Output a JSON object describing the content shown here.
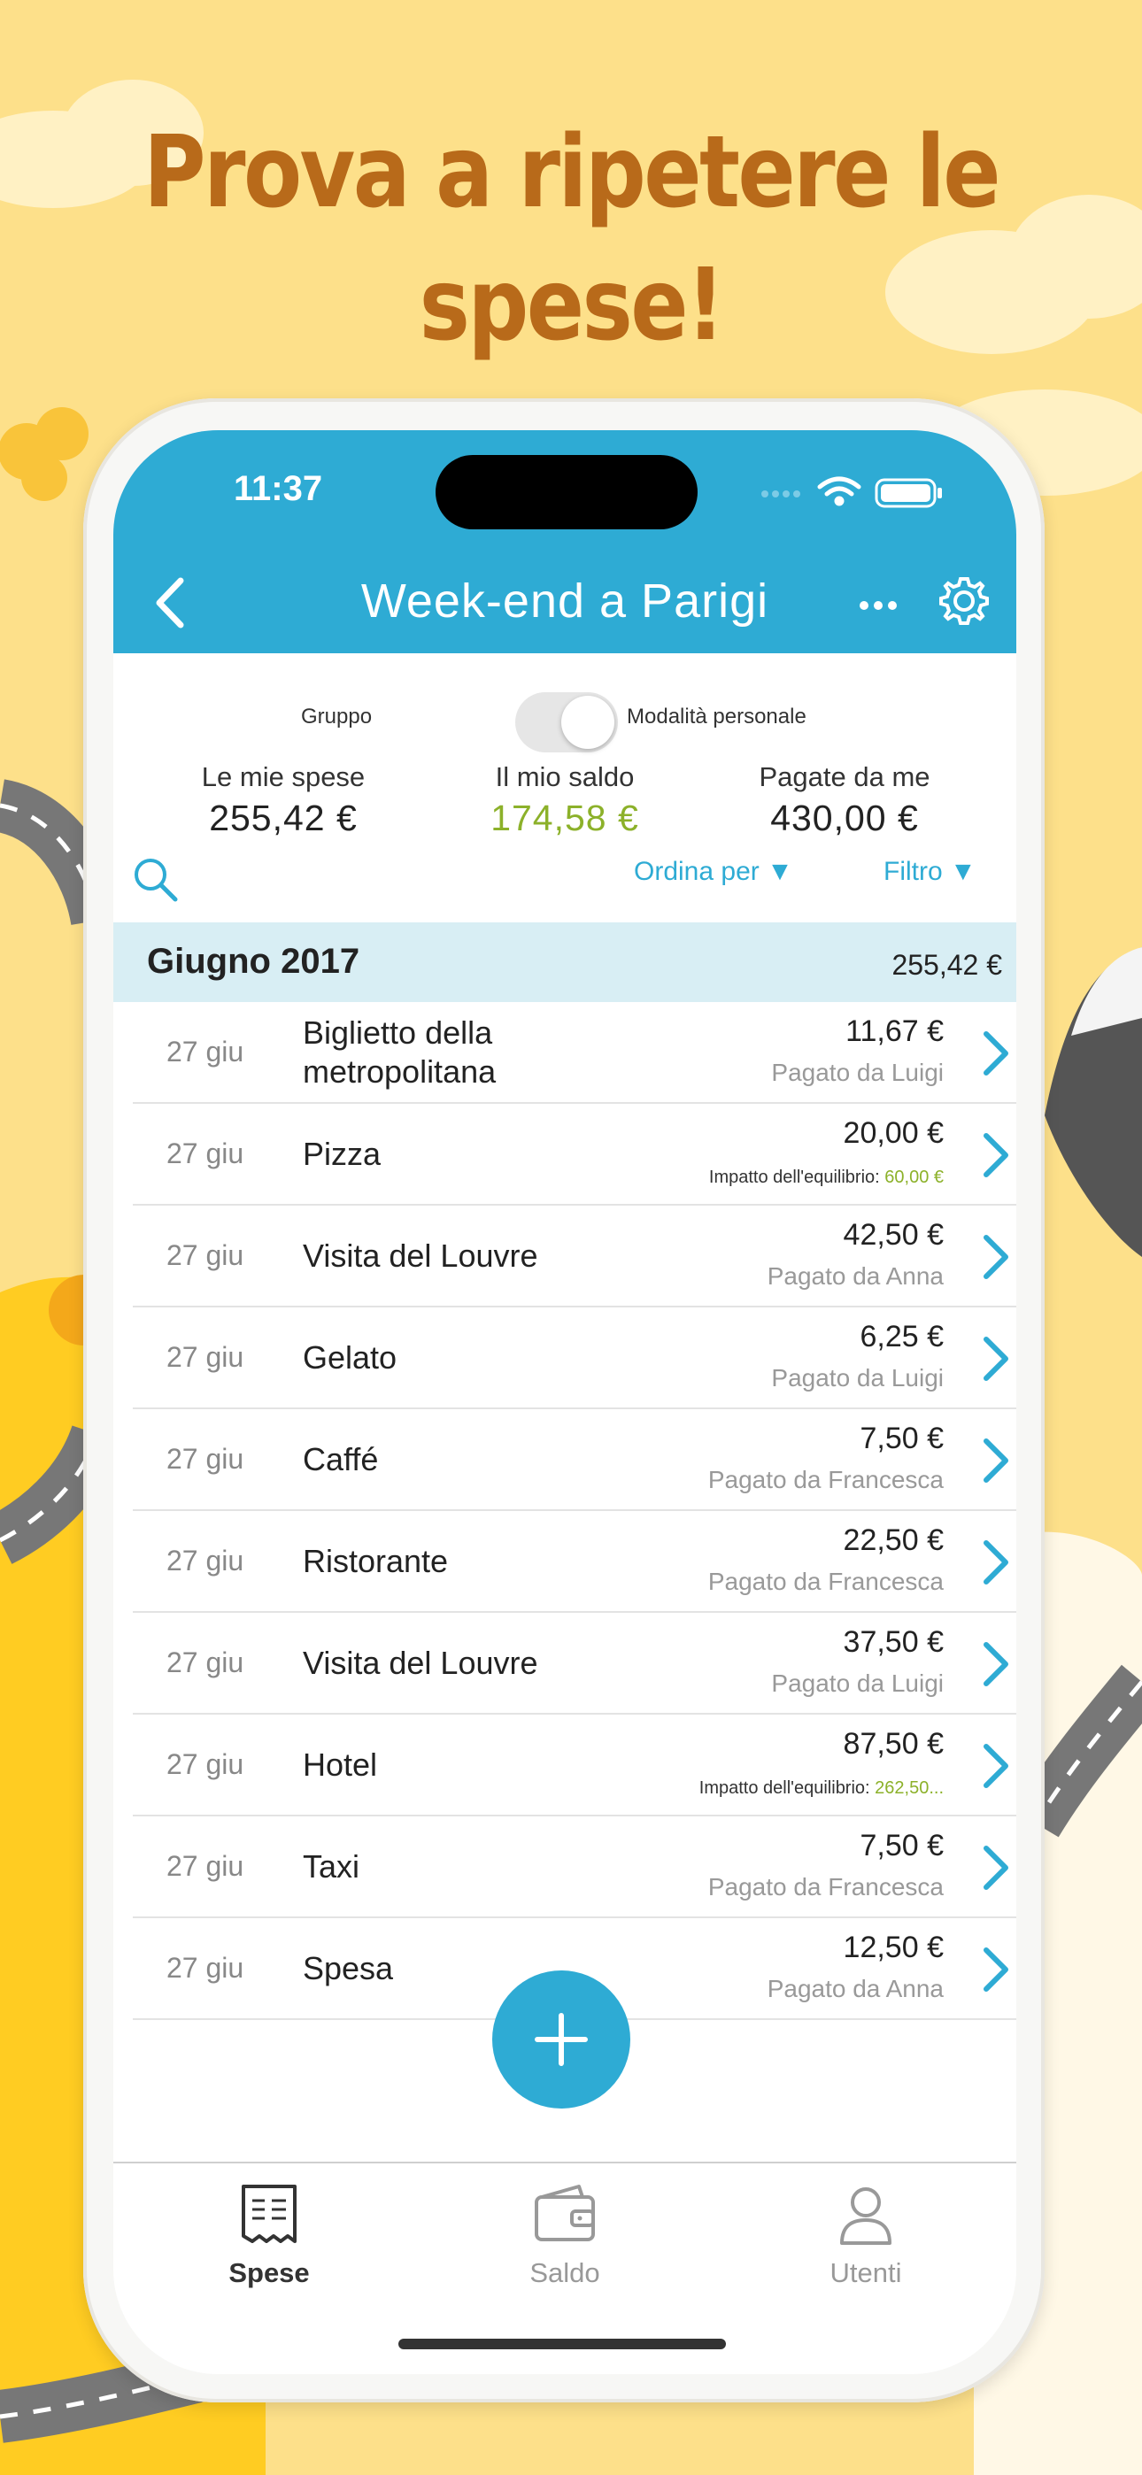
{
  "headline": "Prova a ripetere le spese!",
  "status_bar": {
    "time": "11:37"
  },
  "nav": {
    "title": "Week-end a Parigi"
  },
  "mode_toggle": {
    "left_label": "Gruppo",
    "right_label": "Modalità personale"
  },
  "summary": [
    {
      "label": "Le mie spese",
      "value": "255,42 €"
    },
    {
      "label": "Il mio saldo",
      "value": "174,58 €"
    },
    {
      "label": "Pagate da me",
      "value": "430,00 €"
    }
  ],
  "toolbar": {
    "sort_label": "Ordina per ▼",
    "filter_label": "Filtro ▼"
  },
  "month": {
    "title": "Giugno 2017",
    "total": "255,42 €"
  },
  "expenses": [
    {
      "date": "27 giu",
      "name": "Biglietto della metropolitana",
      "amount": "11,67 €",
      "sub": "Pagato da Luigi",
      "impact": false
    },
    {
      "date": "27 giu",
      "name": "Pizza",
      "amount": "20,00 €",
      "sub": "Impatto dell'equilibrio: ",
      "impact_value": "60,00 €",
      "impact": true
    },
    {
      "date": "27 giu",
      "name": "Visita del Louvre",
      "amount": "42,50 €",
      "sub": "Pagato da Anna",
      "impact": false
    },
    {
      "date": "27 giu",
      "name": "Gelato",
      "amount": "6,25 €",
      "sub": "Pagato da Luigi",
      "impact": false
    },
    {
      "date": "27 giu",
      "name": "Caffé",
      "amount": "7,50 €",
      "sub": "Pagato da Francesca",
      "impact": false
    },
    {
      "date": "27 giu",
      "name": "Ristorante",
      "amount": "22,50 €",
      "sub": "Pagato da Francesca",
      "impact": false
    },
    {
      "date": "27 giu",
      "name": "Visita del Louvre",
      "amount": "37,50 €",
      "sub": "Pagato da Luigi",
      "impact": false
    },
    {
      "date": "27 giu",
      "name": "Hotel",
      "amount": "87,50 €",
      "sub": "Impatto dell'equilibrio: ",
      "impact_value": "262,50...",
      "impact": true
    },
    {
      "date": "27 giu",
      "name": "Taxi",
      "amount": "7,50 €",
      "sub": "Pagato da Francesca",
      "impact": false
    },
    {
      "date": "27 giu",
      "name": "Spesa",
      "amount": "12,50 €",
      "sub": "Pagato da Anna",
      "impact": false
    }
  ],
  "tabs": [
    {
      "label": "Spese",
      "icon": "receipt-icon",
      "active": true
    },
    {
      "label": "Saldo",
      "icon": "wallet-icon",
      "active": false
    },
    {
      "label": "Utenti",
      "icon": "user-icon",
      "active": false
    }
  ],
  "colors": {
    "accent": "#2eabd4",
    "positive": "#8cb12a",
    "background": "#fde08a",
    "headline": "#b86a1a"
  }
}
